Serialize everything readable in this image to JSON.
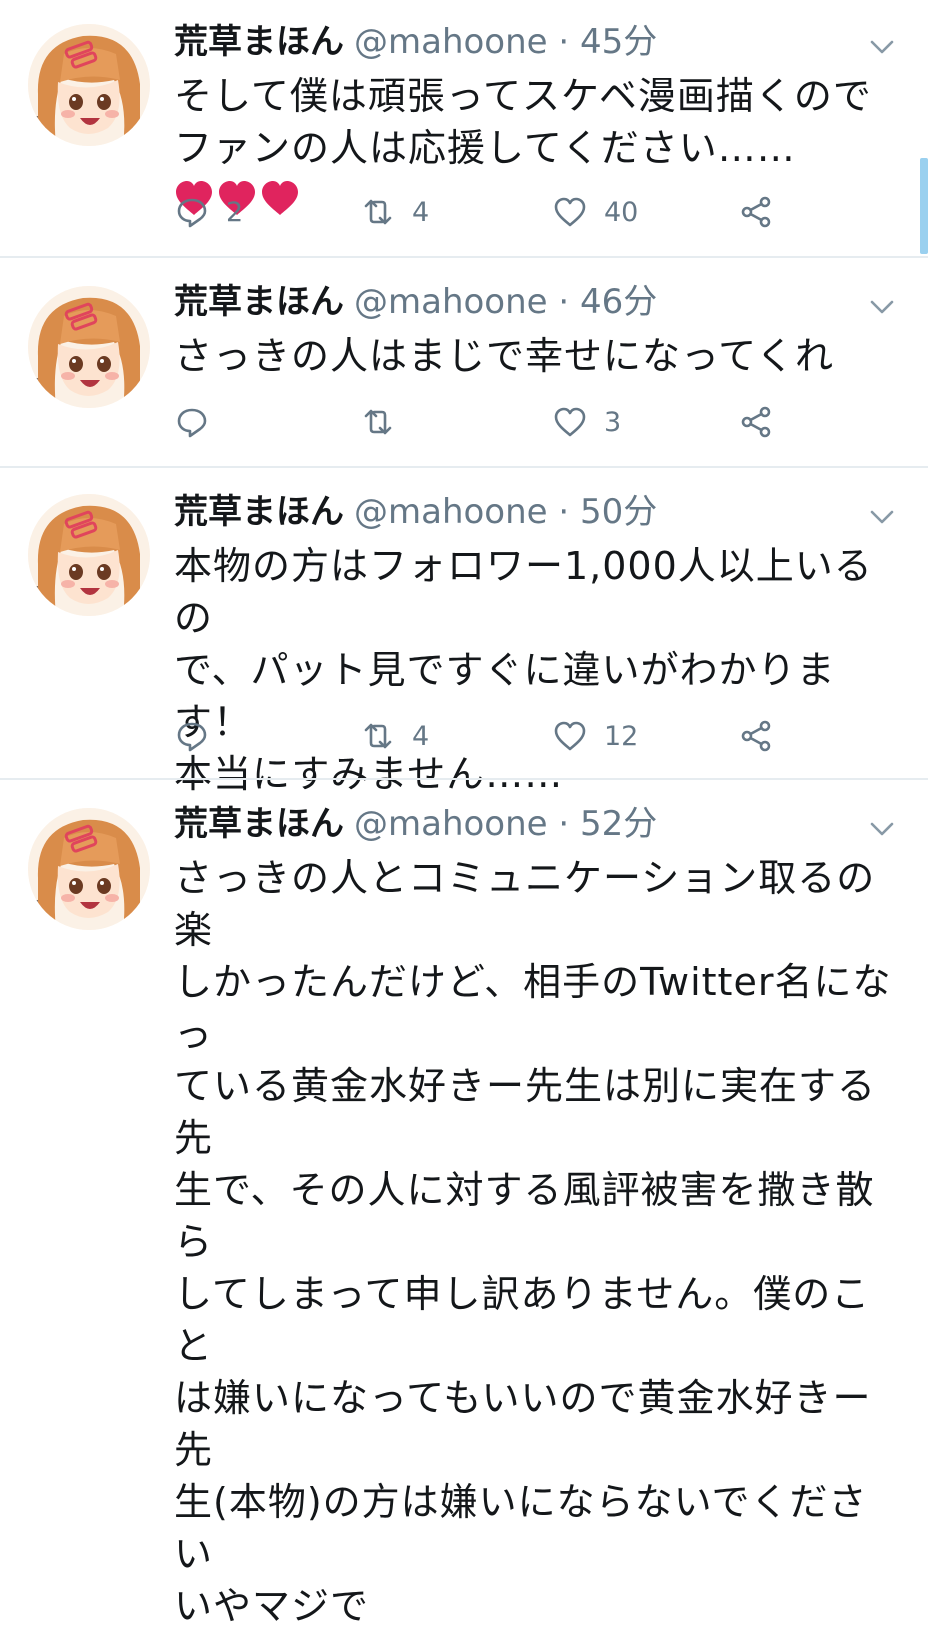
{
  "tweets": [
    {
      "name": "荒草まほん",
      "meta": "@mahoone · 45分",
      "text": "そして僕は頑張ってスケベ漫画描くので\nファンの人は応援してください……",
      "hearts": "❤❤❤",
      "replies": "2",
      "retweets": "4",
      "likes": "40"
    },
    {
      "name": "荒草まほん",
      "meta": "@mahoone · 46分",
      "text": "さっきの人はまじで幸せになってくれ",
      "replies": "",
      "retweets": "",
      "likes": "3"
    },
    {
      "name": "荒草まほん",
      "meta": "@mahoone · 50分",
      "text": "本物の方はフォロワー1,000人以上いるの\nで、パット見ですぐに違いがわかります！\n本当にすみません……",
      "replies": "",
      "retweets": "4",
      "likes": "12"
    },
    {
      "name": "荒草まほん",
      "meta": "@mahoone · 52分",
      "text": "さっきの人とコミュニケーション取るの楽\nしかったんだけど、相手のTwitter名になっ\nている黄金水好きー先生は別に実在する先\n生で、その人に対する風評被害を撒き散ら\nしてしまって申し訳ありません。僕のこと\nは嫌いになってもいいので黄金水好きー先\n生(本物)の方は嫌いにならないでください\nいやマジで"
    }
  ],
  "colors": {
    "text": "#14171a",
    "secondary": "#657786",
    "divider": "#e6ecf0",
    "heart": "#e0245e"
  },
  "icons": [
    "avatar-illustration",
    "chevron-down-icon",
    "reply-icon",
    "retweet-icon",
    "like-icon",
    "share-icon",
    "heart-emoji"
  ]
}
